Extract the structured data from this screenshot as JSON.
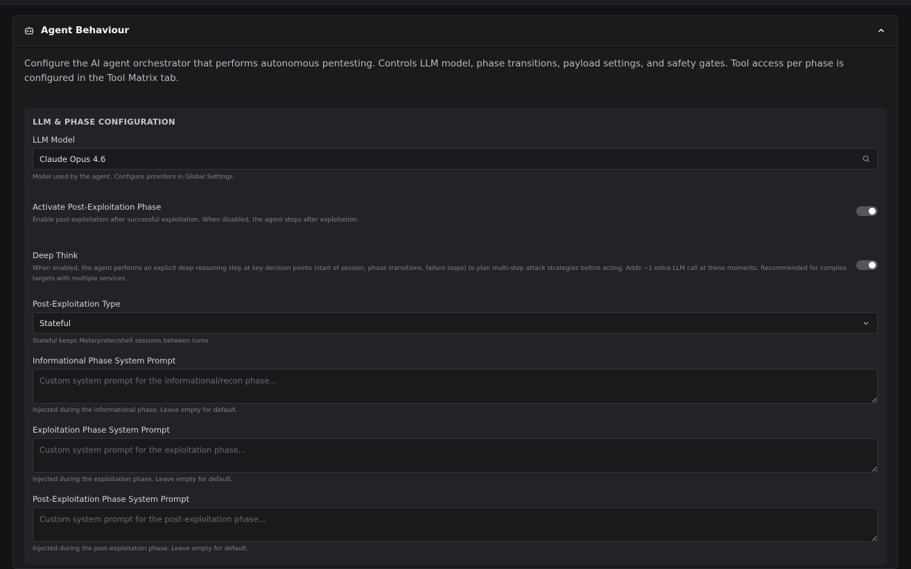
{
  "card": {
    "title": "Agent Behaviour",
    "description": "Configure the AI agent orchestrator that performs autonomous pentesting. Controls LLM model, phase transitions, payload settings, and safety gates. Tool access per phase is configured in the Tool Matrix tab."
  },
  "section": {
    "title": "LLM & PHASE CONFIGURATION",
    "llm_model": {
      "label": "LLM Model",
      "value": "Claude Opus 4.6",
      "help": "Model used by the agent. Configure providers in Global Settings."
    },
    "post_exploitation_toggle": {
      "label": "Activate Post-Exploitation Phase",
      "help": "Enable post-exploitation after successful exploitation. When disabled, the agent stops after exploitation.",
      "enabled": true
    },
    "deep_think_toggle": {
      "label": "Deep Think",
      "help": "When enabled, the agent performs an explicit deep reasoning step at key decision points (start of session, phase transitions, failure loops) to plan multi-step attack strategies before acting. Adds ~1 extra LLM call at these moments. Recommended for complex targets with multiple services.",
      "enabled": true
    },
    "post_exploitation_type": {
      "label": "Post-Exploitation Type",
      "value": "Stateful",
      "help": "Stateful keeps Meterpreter/shell sessions between turns"
    },
    "informational_prompt": {
      "label": "Informational Phase System Prompt",
      "placeholder": "Custom system prompt for the informational/recon phase...",
      "help": "Injected during the informational phase. Leave empty for default."
    },
    "exploitation_prompt": {
      "label": "Exploitation Phase System Prompt",
      "placeholder": "Custom system prompt for the exploitation phase...",
      "help": "Injected during the exploitation phase. Leave empty for default."
    },
    "post_exploitation_prompt": {
      "label": "Post-Exploitation Phase System Prompt",
      "placeholder": "Custom system prompt for the post-exploitation phase...",
      "help": "Injected during the post-exploitation phase. Leave empty for default."
    }
  },
  "icons": {
    "header": "robot-icon",
    "collapse": "chevron-up-icon",
    "model_search": "search-icon",
    "select_caret": "chevron-down-icon"
  }
}
